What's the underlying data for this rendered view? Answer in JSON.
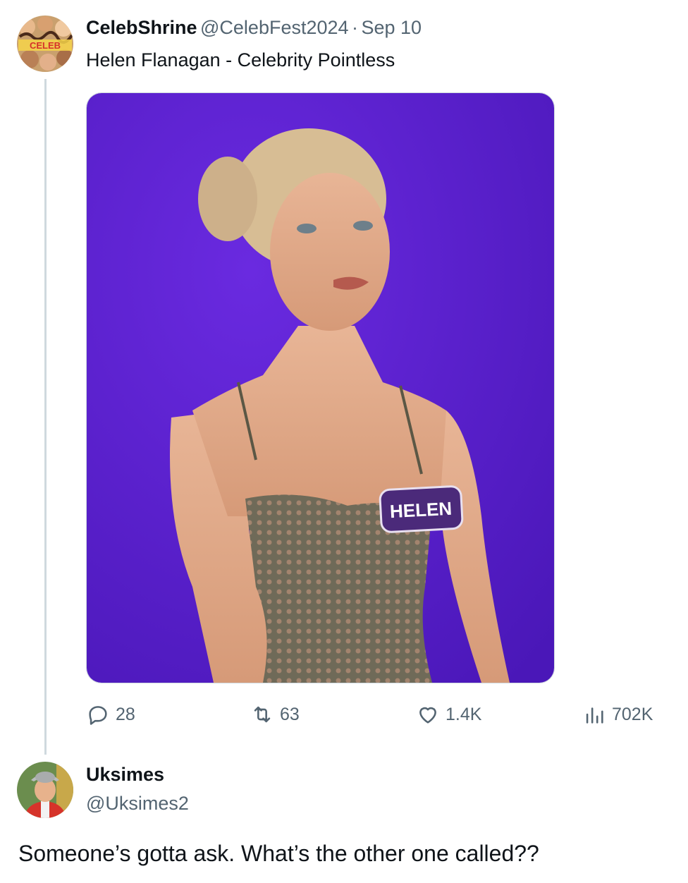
{
  "tweet": {
    "author_name": "CelebShrine",
    "author_handle": "@CelebFest2024",
    "separator": "·",
    "date": "Sep 10",
    "text": "Helen Flanagan - Celebrity Pointless",
    "media": {
      "name_tag": "HELEN",
      "background_color": "#5a1fd1"
    },
    "actions": {
      "replies": "28",
      "retweets": "63",
      "likes": "1.4K",
      "views": "702K"
    }
  },
  "reply": {
    "author_name": "Uksimes",
    "author_handle": "@Uksimes2",
    "text": "Someone’s gotta ask. What’s the other one called??"
  },
  "colors": {
    "text_primary": "#0f1419",
    "text_secondary": "#536471",
    "thread_line": "#cfd9de"
  }
}
